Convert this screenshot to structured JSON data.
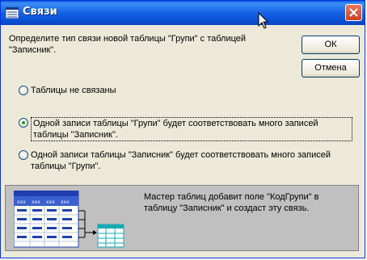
{
  "window": {
    "title": "Связи"
  },
  "dialog": {
    "prompt": "Определите тип связи новой таблицы \"Групи\" с таблицей \"Записник\".",
    "buttons": {
      "ok": "ОК",
      "cancel": "Отмена"
    },
    "options": [
      {
        "label": "Таблицы не связаны",
        "checked": false
      },
      {
        "label": "Одной записи таблицы \"Групи\" будет соответствовать много записей таблицы \"Записник\".",
        "checked": true
      },
      {
        "label": "Одной записи таблицы \"Записник\" будет соответствовать много записей таблицы \"Групи\".",
        "checked": false
      }
    ],
    "info": "Мастер таблиц добавит поле \"КодГрупи\" в таблицу \"Записник\" и создаст эту связь.",
    "illustration_cells": [
      "xxx",
      "xxx",
      "xxx",
      "xxx"
    ]
  },
  "colors": {
    "titlebar": "#0a5ddc",
    "dialog_bg": "#ece9d8",
    "info_panel": "#c0c0c0",
    "radio_checked": "#21a121",
    "table_header": "#1f3fb0",
    "table_small": "#18a8b0"
  }
}
